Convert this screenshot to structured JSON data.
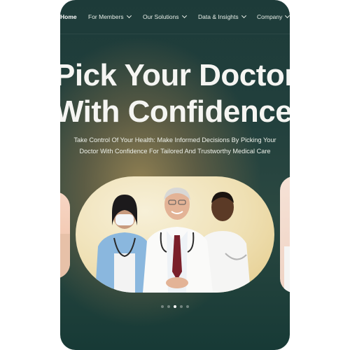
{
  "nav": {
    "items": [
      {
        "label": "Home",
        "active": true,
        "dropdown": false
      },
      {
        "label": "For Members",
        "active": false,
        "dropdown": true
      },
      {
        "label": "Our Solutions",
        "active": false,
        "dropdown": true
      },
      {
        "label": "Data & Insights",
        "active": false,
        "dropdown": true
      },
      {
        "label": "Company",
        "active": false,
        "dropdown": true
      }
    ]
  },
  "hero": {
    "headline_line1": "Pick Your Doctor",
    "headline_line2": "With Confidence",
    "subtitle_line1": "Take Control Of Your Health: Make Informed Decisions By Picking Your",
    "subtitle_line2": "Doctor With Confidence For Tailored And Trustworthy Medical Care"
  },
  "carousel": {
    "slide_count": 5,
    "active_index": 2
  },
  "colors": {
    "background_dark": "#1d3b39",
    "accent_gold": "#e4cb8a",
    "text_light": "#f5f5f2"
  }
}
